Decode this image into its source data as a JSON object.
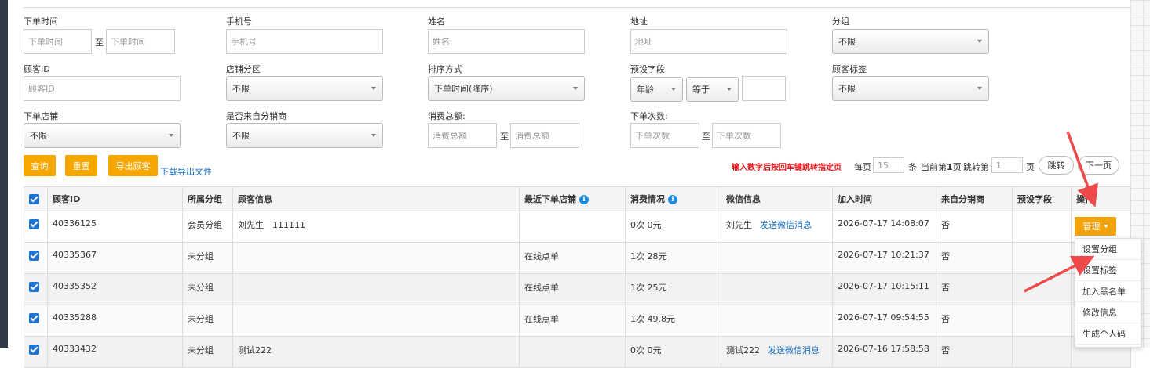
{
  "filters": {
    "order_time": {
      "label": "下单时间",
      "from_placeholder": "下单时间",
      "to_label": "至",
      "to_placeholder": "下单时间"
    },
    "phone": {
      "label": "手机号",
      "placeholder": "手机号"
    },
    "name": {
      "label": "姓名",
      "placeholder": "姓名"
    },
    "address": {
      "label": "地址",
      "placeholder": "地址"
    },
    "group": {
      "label": "分组",
      "value": "不限"
    },
    "customer_id": {
      "label": "顾客ID",
      "placeholder": "顾客ID"
    },
    "store_zone": {
      "label": "店铺分区",
      "value": "不限"
    },
    "sort": {
      "label": "排序方式",
      "value": "下单时间(降序)"
    },
    "preset_field": {
      "label": "预设字段",
      "field": "年龄",
      "op": "等于",
      "value": ""
    },
    "customer_tag": {
      "label": "顾客标签",
      "value": "不限"
    },
    "store": {
      "label": "下单店铺",
      "value": "不限"
    },
    "from_distributor": {
      "label": "是否来自分销商",
      "value": "不限"
    },
    "total_spend": {
      "label": "消费总额:",
      "from_placeholder": "消费总额",
      "to_label": "至",
      "to_placeholder": "消费总额"
    },
    "order_count": {
      "label": "下单次数:",
      "from_placeholder": "下单次数",
      "to_label": "至",
      "to_placeholder": "下单次数"
    }
  },
  "actions": {
    "query": "查询",
    "reset": "重置",
    "export": "导出顾客",
    "download": "下载导出文件"
  },
  "pager": {
    "hint": "输入数字后按回车键跳转指定页",
    "per_page_label": "每页",
    "per_page_value": "15",
    "per_page_unit": "条",
    "current_label": "当前第",
    "current_page": "1",
    "page_unit": "页",
    "jump_label": "跳转第",
    "jump_value": "1",
    "jump_unit": "页",
    "jump_button": "跳转",
    "next_button": "下一页"
  },
  "table": {
    "headers": [
      "顾客ID",
      "所属分组",
      "顾客信息",
      "最近下单店铺",
      "消费情况",
      "微信信息",
      "加入时间",
      "来自分销商",
      "预设字段",
      "操作"
    ],
    "rows": [
      {
        "id": "40336125",
        "group": "会员分组",
        "info": "刘先生　111111",
        "store": "",
        "spend": "0次 0元",
        "wechat": "刘先生",
        "wechat_link": "发送微信消息",
        "joined": "2026-07-17 14:08:07",
        "distributor": "否",
        "preset": ""
      },
      {
        "id": "40335367",
        "group": "未分组",
        "info": "",
        "store": "在线点单",
        "spend": "1次 28元",
        "wechat": "",
        "wechat_link": "",
        "joined": "2026-07-17 10:21:37",
        "distributor": "否",
        "preset": ""
      },
      {
        "id": "40335352",
        "group": "未分组",
        "info": "",
        "store": "在线点单",
        "spend": "1次 25元",
        "wechat": "",
        "wechat_link": "",
        "joined": "2026-07-17 10:15:11",
        "distributor": "否",
        "preset": ""
      },
      {
        "id": "40335288",
        "group": "未分组",
        "info": "",
        "store": "在线点单",
        "spend": "1次 49.8元",
        "wechat": "",
        "wechat_link": "",
        "joined": "2026-07-17 09:54:55",
        "distributor": "否",
        "preset": ""
      },
      {
        "id": "40333432",
        "group": "未分组",
        "info": "测试222",
        "store": "",
        "spend": "0次 0元",
        "wechat": "测试222",
        "wechat_link": "发送微信消息",
        "joined": "2026-07-16 17:58:58",
        "distributor": "否",
        "preset": ""
      }
    ]
  },
  "manage": {
    "button": "管理",
    "menu": [
      "设置分组",
      "设置标签",
      "加入黑名单",
      "修改信息",
      "生成个人码"
    ]
  },
  "colors": {
    "accent": "#f5a700",
    "checkbox": "#1e73d2",
    "link": "#1a6fc0",
    "warn": "#e5161a",
    "arrow": "#ee4a4a"
  },
  "icons": {
    "info": "info-icon",
    "caret": "chevron-down-icon",
    "checkbox": "checkbox-checked-icon",
    "arrow": "annotation-arrow-icon"
  }
}
